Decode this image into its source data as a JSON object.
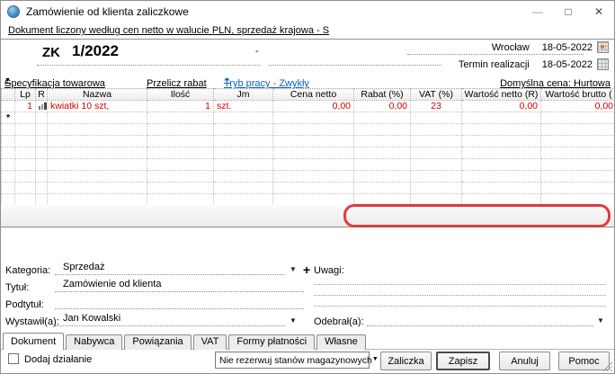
{
  "window": {
    "title": "Zamówienie od klienta zaliczkowe",
    "info_link": "Dokument liczony według cen netto w walucie PLN, sprzedaż krajowa - S"
  },
  "icons": {
    "minimize": "—",
    "maximize": "□",
    "close": "✕",
    "dropdown": "▼",
    "new_row_marker": "*"
  },
  "header": {
    "doc_symbol": "ZK",
    "doc_number": "1/2022",
    "contractor_placeholder": "-",
    "city": "Wrocław",
    "issue_date": "18-05-2022",
    "term_label": "Termin realizacji",
    "term_date": "18-05-2022"
  },
  "toolbar": {
    "spec": "Specyfikacja towarowa",
    "recalc": "Przelicz rabat",
    "mode": "Tryb pracy - Zwykły",
    "default_price": "Domyślna cena: Hurtowa"
  },
  "table": {
    "columns": [
      "Lp",
      "R",
      "Nazwa",
      "Ilość",
      "Jm",
      "Cena netto",
      "Rabat (%)",
      "VAT (%)",
      "Wartość netto (R)",
      "Wartość brutto ("
    ],
    "row": {
      "lp": "1",
      "name": "kwiatki 10 szt,",
      "qty": "1",
      "unit": "szt.",
      "price": "0,00",
      "discount": "0,00",
      "vat": "23",
      "net": "0,00",
      "gross": "0,00"
    }
  },
  "form": {
    "category_label": "Kategoria:",
    "category_value": "Sprzedaż",
    "add_button": "+",
    "title_label": "Tytuł:",
    "title_value": "Zamówienie od klienta",
    "subtitle_label": "Podtytuł:",
    "subtitle_value": "",
    "issuer_label": "Wystawił(a):",
    "issuer_value": "Jan Kowalski",
    "notes_label": "Uwagi:",
    "receiver_label": "Odebrał(a):",
    "receiver_value": ""
  },
  "tabs": [
    "Dokument",
    "Nabywca",
    "Powiązania",
    "VAT",
    "Formy płatności",
    "Własne"
  ],
  "bottom": {
    "checkbox_label": "Dodaj działanie",
    "stock_option": "Nie rezerwuj stanów magazynowych",
    "buttons": {
      "advance": "Zaliczka",
      "save": "Zapisz",
      "cancel": "Anuluj",
      "help": "Pomoc"
    }
  },
  "colors": {
    "red_text": "#d40000",
    "annotation": "#e23b3b",
    "link_blue": "#0b62c4"
  }
}
